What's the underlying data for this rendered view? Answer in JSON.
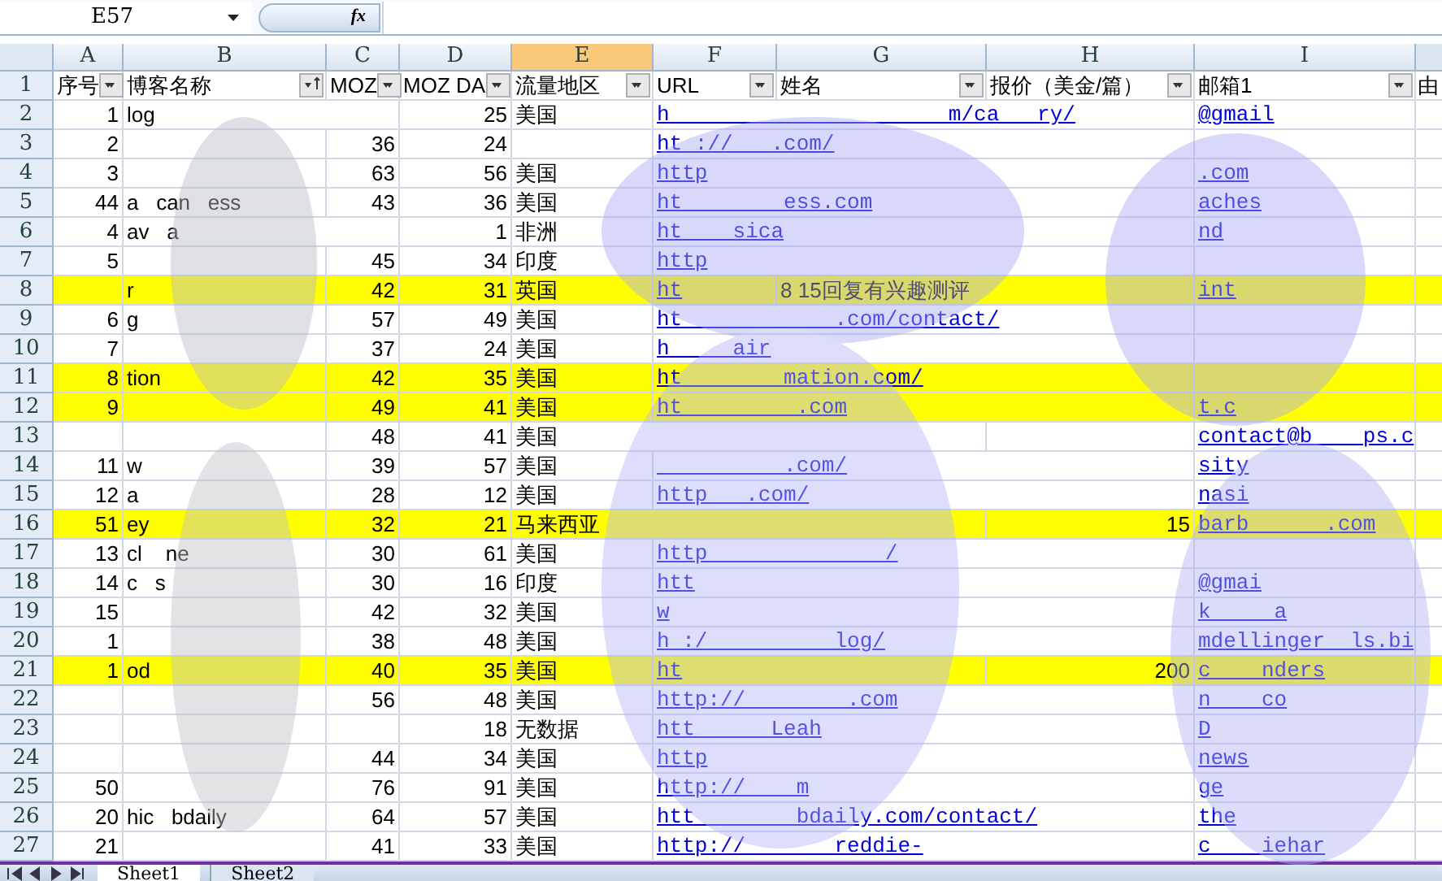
{
  "name_box": "E57",
  "formula_label": "fx",
  "columns": [
    {
      "letter": "A",
      "selected": false
    },
    {
      "letter": "B",
      "selected": false
    },
    {
      "letter": "C",
      "selected": false
    },
    {
      "letter": "D",
      "selected": false
    },
    {
      "letter": "E",
      "selected": true
    },
    {
      "letter": "F",
      "selected": false
    },
    {
      "letter": "G",
      "selected": false
    },
    {
      "letter": "H",
      "selected": false
    },
    {
      "letter": "I",
      "selected": false
    }
  ],
  "header_row": {
    "row": "1",
    "cells": [
      {
        "text": "序号",
        "kind": "filter",
        "sorted": false
      },
      {
        "text": "博客名称",
        "kind": "filter",
        "sorted": true
      },
      {
        "text": "MOZ",
        "kind": "filter",
        "sorted": false
      },
      {
        "text": "MOZ DA",
        "kind": "filter",
        "sorted": false
      },
      {
        "text": "流量地区",
        "kind": "filter",
        "sorted": false
      },
      {
        "text": "URL",
        "kind": "filter",
        "sorted": false
      },
      {
        "text": "姓名",
        "kind": "filter",
        "sorted": false
      },
      {
        "text": "报价（美金/篇）",
        "kind": "filter",
        "sorted": false
      },
      {
        "text": "邮箱1",
        "kind": "filter",
        "sorted": false
      },
      {
        "text": "由",
        "kind": "plain"
      }
    ]
  },
  "rows": [
    {
      "row": "2",
      "highlighted": false,
      "a": "1",
      "b": "log",
      "d": "25",
      "e": "美国",
      "f": "h                      m/ca   ry/",
      "i": "@gmail"
    },
    {
      "row": "3",
      "highlighted": false,
      "a": "2",
      "c": "36",
      "d": "24",
      "f": "ht ://   .com/"
    },
    {
      "row": "4",
      "highlighted": false,
      "a": "3",
      "c": "63",
      "d": "56",
      "e": "美国",
      "f": "http",
      "i": ".com"
    },
    {
      "row": "5",
      "highlighted": false,
      "a": "44",
      "b": "a   can   ess",
      "c": "43",
      "d": "36",
      "e": "美国",
      "f": "ht        ess.com",
      "i": "aches"
    },
    {
      "row": "6",
      "highlighted": false,
      "a": "4",
      "b": "av   a",
      "d": "1",
      "e": "非洲",
      "f": "ht    sica",
      "i": "nd"
    },
    {
      "row": "7",
      "highlighted": false,
      "a": "5",
      "c": "45",
      "d": "34",
      "e": "印度",
      "f": "http"
    },
    {
      "row": "8",
      "highlighted": true,
      "b": "r",
      "c": "42",
      "d": "31",
      "e": "英国",
      "f": "ht",
      "g": "8 15回复有兴趣测评",
      "i": "int"
    },
    {
      "row": "9",
      "highlighted": false,
      "a": "6",
      "b": "g",
      "c": "57",
      "d": "49",
      "e": "美国",
      "f": "ht            .com/contact/"
    },
    {
      "row": "10",
      "highlighted": false,
      "a": "7",
      "c": "37",
      "d": "24",
      "e": "美国",
      "f": "h     air"
    },
    {
      "row": "11",
      "highlighted": true,
      "a": "8",
      "b": "tion",
      "c": "42",
      "d": "35",
      "e": "美国",
      "f": "ht        mation.com/"
    },
    {
      "row": "12",
      "highlighted": true,
      "a": "9",
      "c": "49",
      "d": "41",
      "e": "美国",
      "f": "ht         .com",
      "i": "t.c"
    },
    {
      "row": "13",
      "highlighted": false,
      "c": "48",
      "d": "41",
      "e": "美国",
      "i": "contact@b    ps.c"
    },
    {
      "row": "14",
      "highlighted": false,
      "a": "11",
      "b": "w",
      "c": "39",
      "d": "57",
      "e": "美国",
      "f": "          .com/",
      "i": "sity"
    },
    {
      "row": "15",
      "highlighted": false,
      "a": "12",
      "b": "a",
      "c": "28",
      "d": "12",
      "e": "美国",
      "f": "http   .com/",
      "i": "nasi"
    },
    {
      "row": "16",
      "highlighted": true,
      "a": "51",
      "b": "ey",
      "c": "32",
      "d": "21",
      "e": "马来西亚",
      "h": "15",
      "i": "barb      .com"
    },
    {
      "row": "17",
      "highlighted": false,
      "a": "13",
      "b": "cl    ne",
      "c": "30",
      "d": "61",
      "e": "美国",
      "f": "http              /"
    },
    {
      "row": "18",
      "highlighted": false,
      "a": "14",
      "b": "c   s",
      "c": "30",
      "d": "16",
      "e": "印度",
      "f": "htt",
      "i": "@gmai"
    },
    {
      "row": "19",
      "highlighted": false,
      "a": "15",
      "c": "42",
      "d": "32",
      "e": "美国",
      "f": "w",
      "i": "k     a"
    },
    {
      "row": "20",
      "highlighted": false,
      "a": "1",
      "c": "38",
      "d": "48",
      "e": "美国",
      "f": "h :/          log/",
      "i": "mdellinger  ls.bi"
    },
    {
      "row": "21",
      "highlighted": true,
      "a": "1",
      "b": "od",
      "c": "40",
      "d": "35",
      "e": "美国",
      "f": "ht",
      "h": "200",
      "i": "c    nders"
    },
    {
      "row": "22",
      "highlighted": false,
      "c": "56",
      "d": "48",
      "e": "美国",
      "f": "http://        .com",
      "i": "n    co"
    },
    {
      "row": "23",
      "highlighted": false,
      "d": "18",
      "e": "无数据",
      "f": "htt      Leah",
      "i": "D"
    },
    {
      "row": "24",
      "highlighted": false,
      "c": "44",
      "d": "34",
      "e": "美国",
      "f": "http",
      "i": "news"
    },
    {
      "row": "25",
      "highlighted": false,
      "a": "50",
      "c": "76",
      "d": "91",
      "e": "美国",
      "f": "http://    m",
      "i": "ge"
    },
    {
      "row": "26",
      "highlighted": false,
      "a": "20",
      "b": "hic   bdaily",
      "c": "64",
      "d": "57",
      "e": "美国",
      "f": "htt        bdaily.com/contact/",
      "i": "the"
    },
    {
      "row": "27",
      "highlighted": false,
      "a": "21",
      "c": "41",
      "d": "33",
      "e": "美国",
      "f": "http://       reddie-",
      "i": "c    iehar"
    }
  ],
  "sheet_tabs": [
    {
      "label": "Sheet1",
      "selected": true
    },
    {
      "label": "Sheet2",
      "selected": false
    }
  ]
}
